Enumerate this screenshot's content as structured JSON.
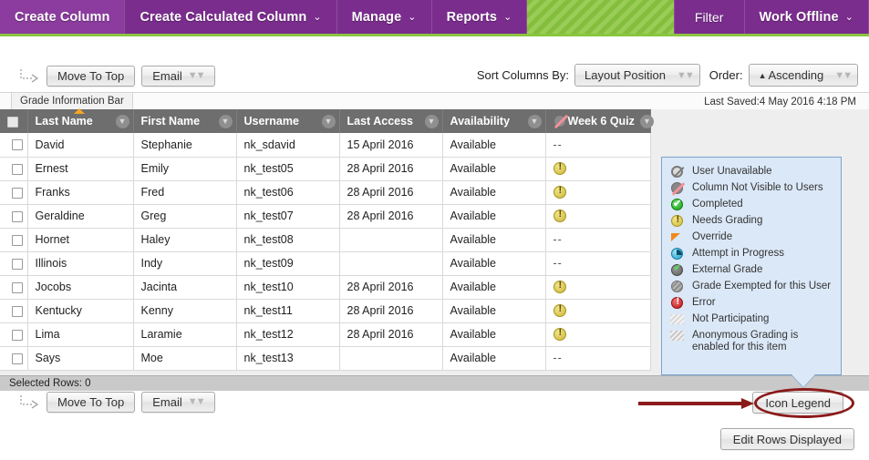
{
  "nav": {
    "items": [
      {
        "label": "Create Column",
        "caret": "",
        "active": true
      },
      {
        "label": "Create Calculated Column",
        "caret": "⌄",
        "active": false
      },
      {
        "label": "Manage",
        "caret": "⌄",
        "active": false
      },
      {
        "label": "Reports",
        "caret": "⌄",
        "active": false
      }
    ],
    "filter_label": "Filter",
    "work_offline_label": "Work Offline",
    "work_offline_caret": "⌄",
    "purple": "#7b2d8e",
    "green": "#8ac63f"
  },
  "toolbar": {
    "move_to_top_label": "Move To Top",
    "email_label": "Email",
    "sort_columns_by_label": "Sort Columns By:",
    "sort_columns_by_value": "Layout Position",
    "order_label": "Order:",
    "order_value": "Ascending",
    "order_direction_glyph": "▲"
  },
  "grade_info_bar": {
    "tab_label": "Grade Information Bar",
    "last_saved": "Last Saved:4 May 2016 4:18 PM"
  },
  "grid": {
    "columns": [
      {
        "label": "Last Name",
        "sorted": true
      },
      {
        "label": "First Name",
        "sorted": false
      },
      {
        "label": "Username",
        "sorted": false
      },
      {
        "label": "Last Access",
        "sorted": false
      },
      {
        "label": "Availability",
        "sorted": false
      },
      {
        "label": "Week 6 Quiz",
        "sorted": false,
        "not_visible_icon": true
      }
    ],
    "rows": [
      {
        "last_name": "David",
        "first_name": "Stephanie",
        "username": "nk_sdavid",
        "last_access": "15 April 2016",
        "availability": "Available",
        "quiz": "--",
        "quiz_icon": "none"
      },
      {
        "last_name": "Ernest",
        "first_name": "Emily",
        "username": "nk_test05",
        "last_access": "28 April 2016",
        "availability": "Available",
        "quiz": "",
        "quiz_icon": "needs-grading"
      },
      {
        "last_name": "Franks",
        "first_name": "Fred",
        "username": "nk_test06",
        "last_access": "28 April 2016",
        "availability": "Available",
        "quiz": "",
        "quiz_icon": "needs-grading"
      },
      {
        "last_name": "Geraldine",
        "first_name": "Greg",
        "username": "nk_test07",
        "last_access": "28 April 2016",
        "availability": "Available",
        "quiz": "",
        "quiz_icon": "needs-grading"
      },
      {
        "last_name": "Hornet",
        "first_name": "Haley",
        "username": "nk_test08",
        "last_access": "",
        "availability": "Available",
        "quiz": "--",
        "quiz_icon": "none"
      },
      {
        "last_name": "Illinois",
        "first_name": "Indy",
        "username": "nk_test09",
        "last_access": "",
        "availability": "Available",
        "quiz": "--",
        "quiz_icon": "none"
      },
      {
        "last_name": "Jocobs",
        "first_name": "Jacinta",
        "username": "nk_test10",
        "last_access": "28 April 2016",
        "availability": "Available",
        "quiz": "",
        "quiz_icon": "needs-grading"
      },
      {
        "last_name": "Kentucky",
        "first_name": "Kenny",
        "username": "nk_test11",
        "last_access": "28 April 2016",
        "availability": "Available",
        "quiz": "",
        "quiz_icon": "needs-grading"
      },
      {
        "last_name": "Lima",
        "first_name": "Laramie",
        "username": "nk_test12",
        "last_access": "28 April 2016",
        "availability": "Available",
        "quiz": "",
        "quiz_icon": "needs-grading"
      },
      {
        "last_name": "Says",
        "first_name": "Moe",
        "username": "nk_test13",
        "last_access": "",
        "availability": "Available",
        "quiz": "--",
        "quiz_icon": "none"
      }
    ]
  },
  "selected_rows_label": "Selected Rows: 0",
  "legend": {
    "items": [
      {
        "icon": "user-unavailable-icon",
        "label": "User Unavailable"
      },
      {
        "icon": "column-not-visible-icon",
        "label": "Column Not Visible to Users"
      },
      {
        "icon": "completed-icon",
        "label": "Completed"
      },
      {
        "icon": "needs-grading-icon",
        "label": "Needs Grading"
      },
      {
        "icon": "override-icon",
        "label": "Override"
      },
      {
        "icon": "attempt-in-progress-icon",
        "label": "Attempt in Progress"
      },
      {
        "icon": "external-grade-icon",
        "label": "External Grade"
      },
      {
        "icon": "grade-exempted-icon",
        "label": "Grade Exempted for this User"
      },
      {
        "icon": "error-icon",
        "label": "Error"
      },
      {
        "icon": "not-participating-icon",
        "label": "Not Participating"
      },
      {
        "icon": "anonymous-grading-icon",
        "label": "Anonymous Grading is enabled for this item"
      }
    ],
    "background": "#dbe8f7",
    "border": "#7ba3d0"
  },
  "bottom": {
    "icon_legend_label": "Icon Legend",
    "edit_rows_displayed_label": "Edit Rows Displayed"
  },
  "annotation": {
    "color": "#8b1a1a"
  }
}
